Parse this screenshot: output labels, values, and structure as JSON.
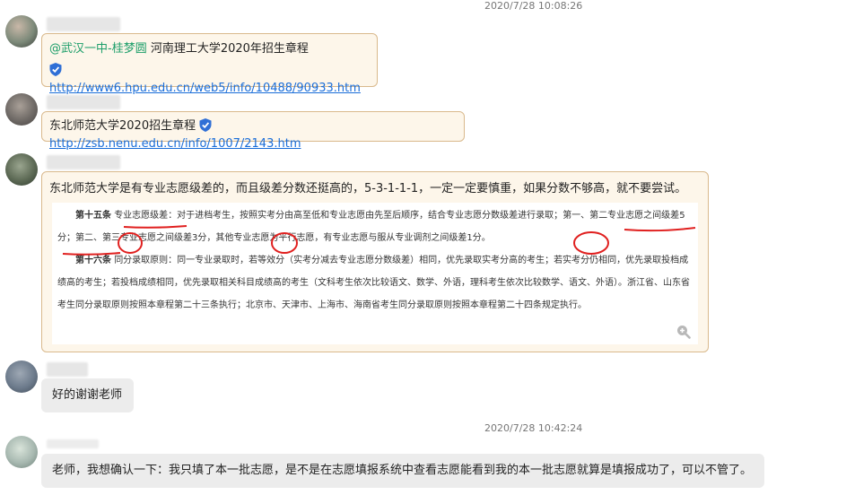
{
  "timestamps": [
    "2020/7/28 10:08:26",
    "2020/7/28 10:42:24"
  ],
  "messages": [
    {
      "mention": "@武汉一中-桂梦圆",
      "text": "河南理工大学2020年招生章程",
      "link": "http://www6.hpu.edu.cn/web5/info/10488/90933.htm"
    },
    {
      "text": "东北师范大学2020招生章程",
      "link": "http://zsb.nenu.edu.cn/info/1007/2143.htm"
    },
    {
      "text": "东北师范大学是有专业志愿级差的，而且级差分数还挺高的，5-3-1-1-1，一定一定要慎重，如果分数不够高，就不要尝试。",
      "doc": {
        "art15_title": "第十五条",
        "art15_head": "专业志愿级差",
        "art15_a": "：对于进档考生，按照实考分由高至低和专业志愿由先至后顺序，结合专业志愿分数级差进行录取；",
        "art15_b": "第一、第二专业志愿之间级差",
        "art15_c1": "5分",
        "art15_c2": "；第二、第三专业志愿之间级差",
        "art15_c3": "3分",
        "art15_c4": "，其他专业志愿为平行志愿，有专业志愿与服从专业调剂之间级差",
        "art15_c5": "1分",
        "art15_c6": "。",
        "art16_title": "第十六条",
        "art16_text": "同分录取原则：同一专业录取时，若等效分（实考分减去专业志愿分数级差）相同，优先录取实考分高的考生；若实考分仍相同，优先录取投档成绩高的考生；若投档成绩相同，优先录取相关科目成绩高的考生（文科考生依次比较语文、数学、外语，理科考生依次比较数学、语文、外语）。浙江省、山东省考生同分录取原则按照本章程第二十三条执行；北京市、天津市、上海市、海南省考生同分录取原则按照本章程第二十四条规定执行。"
      }
    },
    {
      "text": "好的谢谢老师"
    },
    {
      "text": "老师，我想确认一下：我只填了本一批志愿，是不是在志愿填报系统中查看志愿能看到我的本一批志愿就算是填报成功了，可以不管了。"
    }
  ],
  "icons": {
    "security": "shield-check-icon",
    "zoom": "zoom-in-icon"
  },
  "colors": {
    "mention": "#1d9e6a",
    "link": "#1a6dd8",
    "bubble_border": "#d9b98c",
    "ink": "#e0201f"
  }
}
